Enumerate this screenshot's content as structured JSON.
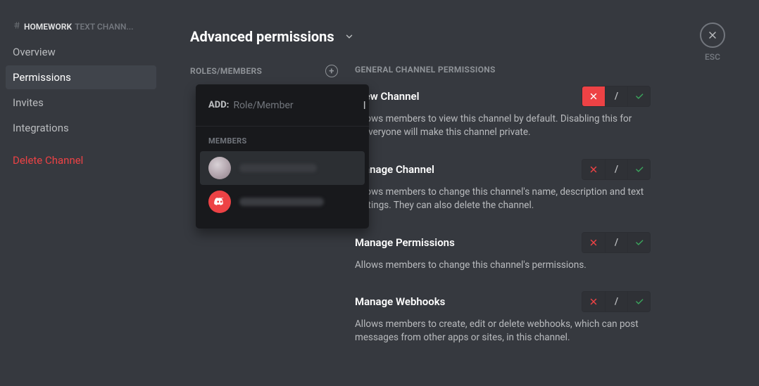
{
  "breadcrumb": {
    "channel_name": "HOMEWORK",
    "channel_type": "TEXT CHANN..."
  },
  "sidebar": {
    "items": [
      {
        "label": "Overview"
      },
      {
        "label": "Permissions"
      },
      {
        "label": "Invites"
      },
      {
        "label": "Integrations"
      }
    ],
    "delete_label": "Delete Channel"
  },
  "page_title": "Advanced permissions",
  "roles_header": "ROLES/MEMBERS",
  "section_header": "GENERAL CHANNEL PERMISSIONS",
  "permissions": [
    {
      "name": "View Channel",
      "desc": "Allows members to view this channel by default. Disabling this for @everyone will make this channel private.",
      "state": "deny"
    },
    {
      "name": "Manage Channel",
      "desc": "Allows members to change this channel's name, description and text settings. They can also delete the channel.",
      "state": "neutral"
    },
    {
      "name": "Manage Permissions",
      "desc": "Allows members to change this channel's permissions.",
      "state": "neutral"
    },
    {
      "name": "Manage Webhooks",
      "desc": "Allows members to create, edit or delete webhooks, which can post messages from other apps or sites, in this channel.",
      "state": "neutral"
    }
  ],
  "esc_label": "ESC",
  "popover": {
    "add_label": "ADD:",
    "placeholder": "Role/Member",
    "members_label": "MEMBERS",
    "members": [
      {
        "name": "████████"
      },
      {
        "name": "████████"
      }
    ]
  },
  "colors": {
    "danger": "#ed4245",
    "allow": "#3ba55d",
    "bg": "#36393f",
    "popover_bg": "#18191c"
  }
}
